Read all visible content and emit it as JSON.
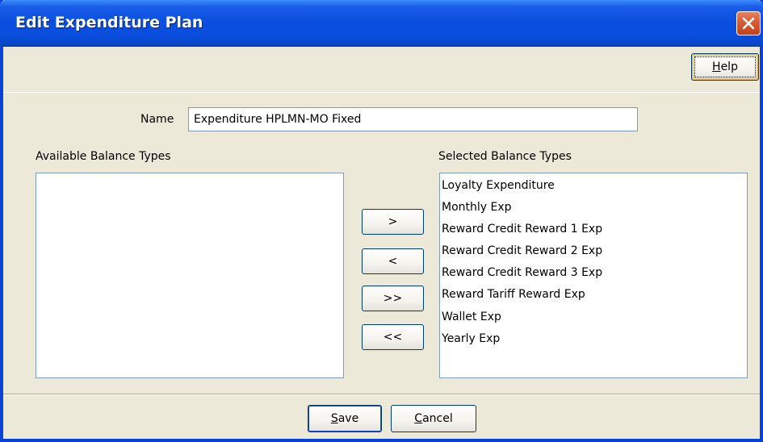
{
  "window": {
    "title": "Edit Expenditure Plan"
  },
  "toolbar": {
    "help_mnemonic": "H",
    "help_rest": "elp"
  },
  "form": {
    "name_label": "Name",
    "name_value": "Expenditure HPLMN-MO Fixed"
  },
  "available": {
    "label": "Available Balance Types",
    "items": []
  },
  "selected": {
    "label": "Selected Balance Types",
    "items": [
      "Loyalty Expenditure",
      "Monthly Exp",
      "Reward Credit Reward 1 Exp",
      "Reward Credit Reward 2 Exp",
      "Reward Credit Reward 3 Exp",
      "Reward Tariff Reward Exp",
      "Wallet Exp",
      "Yearly Exp"
    ]
  },
  "move_buttons": {
    "add": ">",
    "remove": "<",
    "add_all": ">>",
    "remove_all": "<<"
  },
  "footer": {
    "save_mnemonic": "S",
    "save_rest": "ave",
    "cancel_mnemonic": "C",
    "cancel_rest": "ancel"
  },
  "colors": {
    "titlebar": "#0a4ee0",
    "dialog_bg": "#ece9d8",
    "close_button": "#d85a32",
    "button_border": "#003c74"
  },
  "icons": {
    "close": "close-icon"
  }
}
